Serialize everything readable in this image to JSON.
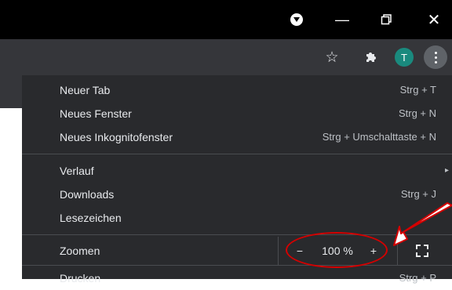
{
  "window": {
    "minimize_glyph": "—",
    "close_glyph": "✕"
  },
  "toolbar": {
    "star_glyph": "☆",
    "avatar_letter": "T"
  },
  "menu": {
    "group1": [
      {
        "label": "Neuer Tab",
        "shortcut": "Strg + T"
      },
      {
        "label": "Neues Fenster",
        "shortcut": "Strg + N"
      },
      {
        "label": "Neues Inkognitofenster",
        "shortcut": "Strg + Umschalttaste + N"
      }
    ],
    "group2": [
      {
        "label": "Verlauf",
        "shortcut": "",
        "submenu_glyph": "▸"
      },
      {
        "label": "Downloads",
        "shortcut": "Strg + J"
      },
      {
        "label": "Lesezeichen",
        "shortcut": ""
      }
    ],
    "zoom": {
      "label": "Zoomen",
      "minus": "−",
      "level": "100 %",
      "plus": "+"
    },
    "group4": [
      {
        "label": "Drucken",
        "shortcut": "Strg + P"
      }
    ]
  },
  "colors": {
    "titlebar": "#000000",
    "toolbar": "#35363a",
    "menu_bg": "#292a2d",
    "avatar": "#1a8a7e",
    "annotation": "#d40000"
  }
}
